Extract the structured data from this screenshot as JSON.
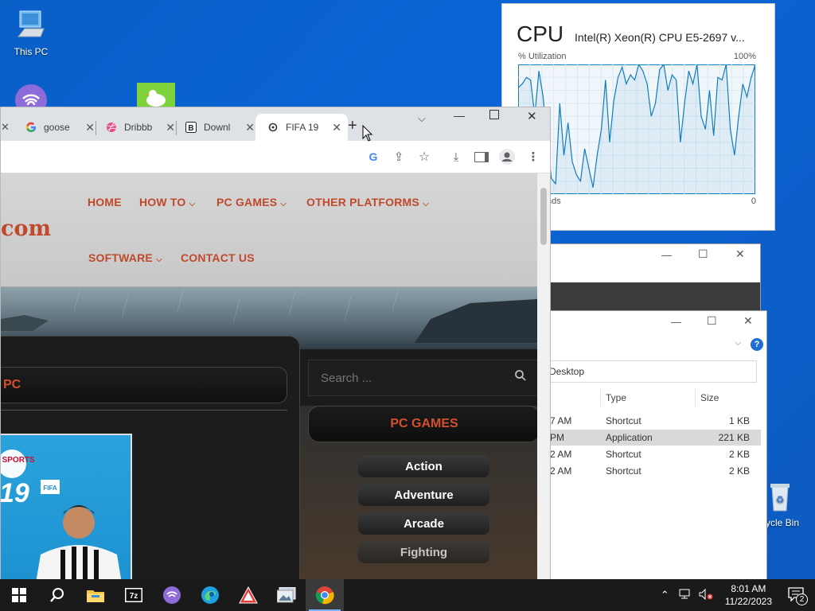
{
  "desktop": {
    "icons": [
      {
        "label": "This PC"
      },
      {
        "label": "cycle Bin"
      }
    ]
  },
  "cpu_widget": {
    "title": "CPU",
    "processor": "Intel(R) Xeon(R) CPU E5-2697 v...",
    "utilization_label": "% Utilization",
    "max_label": "100%",
    "time_label": "nds",
    "min_label": "0",
    "utilization_series": [
      82,
      85,
      90,
      88,
      60,
      95,
      75,
      40,
      12,
      8,
      70,
      30,
      55,
      25,
      15,
      10,
      35,
      20,
      5,
      30,
      50,
      88,
      40,
      72,
      90,
      98,
      85,
      92,
      88,
      100,
      95,
      85,
      60,
      70,
      96,
      100,
      80,
      92,
      88,
      40,
      70,
      95,
      85,
      100,
      60,
      50,
      80,
      45,
      90,
      88,
      100,
      50,
      30,
      60,
      85,
      75,
      90,
      100
    ]
  },
  "window_mid": {
    "controls": [
      "—",
      "☐",
      "✕"
    ]
  },
  "explorer": {
    "address": "Desktop",
    "columns": {
      "type": "Type",
      "size": "Size"
    },
    "rows": [
      {
        "date": "7 AM",
        "type": "Shortcut",
        "size": "1 KB",
        "selected": false
      },
      {
        "date": "PM",
        "type": "Application",
        "size": "221 KB",
        "selected": true
      },
      {
        "date": "2 AM",
        "type": "Shortcut",
        "size": "2 KB",
        "selected": false
      },
      {
        "date": "2 AM",
        "type": "Shortcut",
        "size": "2 KB",
        "selected": false
      }
    ]
  },
  "chrome": {
    "tabs": [
      {
        "label": "goose",
        "icon": "google-icon"
      },
      {
        "label": "Dribbb",
        "icon": "dribbble-icon"
      },
      {
        "label": "Downl",
        "icon": "b-icon"
      },
      {
        "label": "FIFA 19",
        "icon": "site-icon",
        "active": true
      }
    ],
    "new_tab": "+"
  },
  "site": {
    "logo_fragment": "com",
    "nav": [
      "HOME",
      "HOW TO",
      "PC GAMES",
      "OTHER PLATFORMS",
      "SOFTWARE",
      "CONTACT US"
    ],
    "post_title_fragment": "PC",
    "search_placeholder": "Search ...",
    "sidebar_title": "PC GAMES",
    "categories": [
      "Action",
      "Adventure",
      "Arcade",
      "Fighting"
    ],
    "cover": {
      "brand": "EA SPORTS",
      "year": "19",
      "fifa": "FIFA"
    }
  },
  "taskbar": {
    "time": "8:01 AM",
    "date": "11/22/2023",
    "notifications": "2"
  },
  "colors": {
    "accent": "#c0492b",
    "taskbar": "#1a1a1a",
    "desktop": "#0b64d6"
  }
}
